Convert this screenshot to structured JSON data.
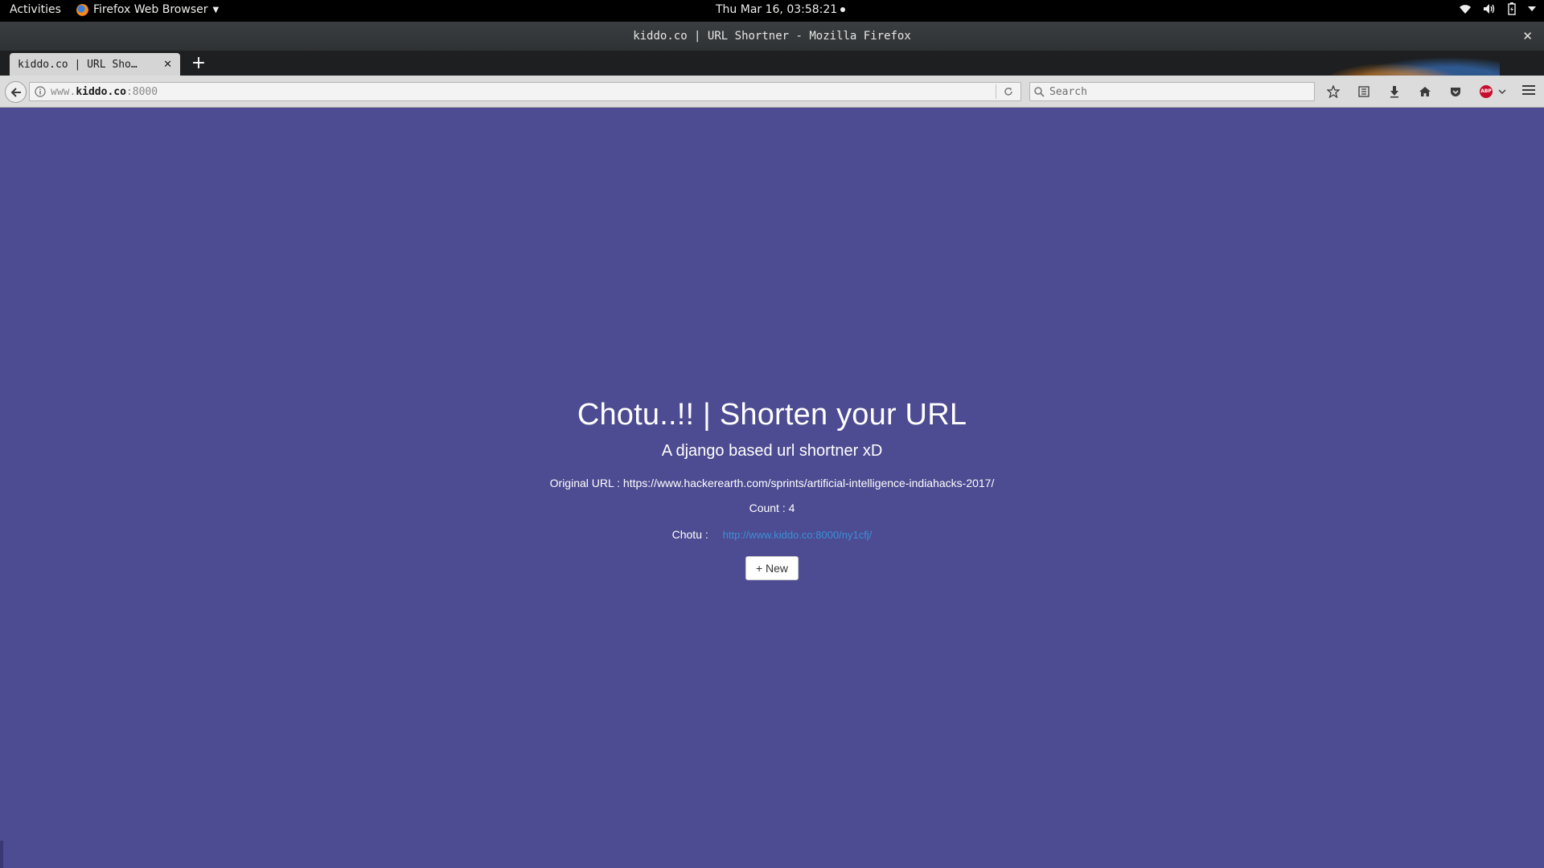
{
  "system_bar": {
    "activities": "Activities",
    "app_menu": "Firefox Web Browser",
    "clock": "Thu Mar 16, 03:58:21"
  },
  "window": {
    "title": "kiddo.co | URL Shortner - Mozilla Firefox"
  },
  "tabs": [
    {
      "label": "kiddo.co | URL Sho…",
      "active": true
    }
  ],
  "navbar": {
    "url_prefix": "www.",
    "url_domain": "kiddo.co",
    "url_port": ":8000",
    "search_placeholder": "Search"
  },
  "icons": {
    "toolbar": [
      "bookmark-star-icon",
      "reader-list-icon",
      "download-icon",
      "home-icon",
      "pocket-icon",
      "adblock-plus-icon",
      "menu-icon"
    ]
  },
  "page": {
    "title": "Chotu..!! | Shorten your URL",
    "subtitle": "A django based url shortner xD",
    "original_url_text": "Original URL : https://www.hackerearth.com/sprints/artificial-intelligence-indiahacks-2017/",
    "count_text": "Count : 4",
    "chotu_label": "Chotu :",
    "short_url": "http://www.kiddo.co:8000/ny1cfj/",
    "new_button": "+ New"
  },
  "colors": {
    "page_background": "#4d4b91",
    "link": "#3b8fd9",
    "abp_red": "#c70d2c"
  }
}
